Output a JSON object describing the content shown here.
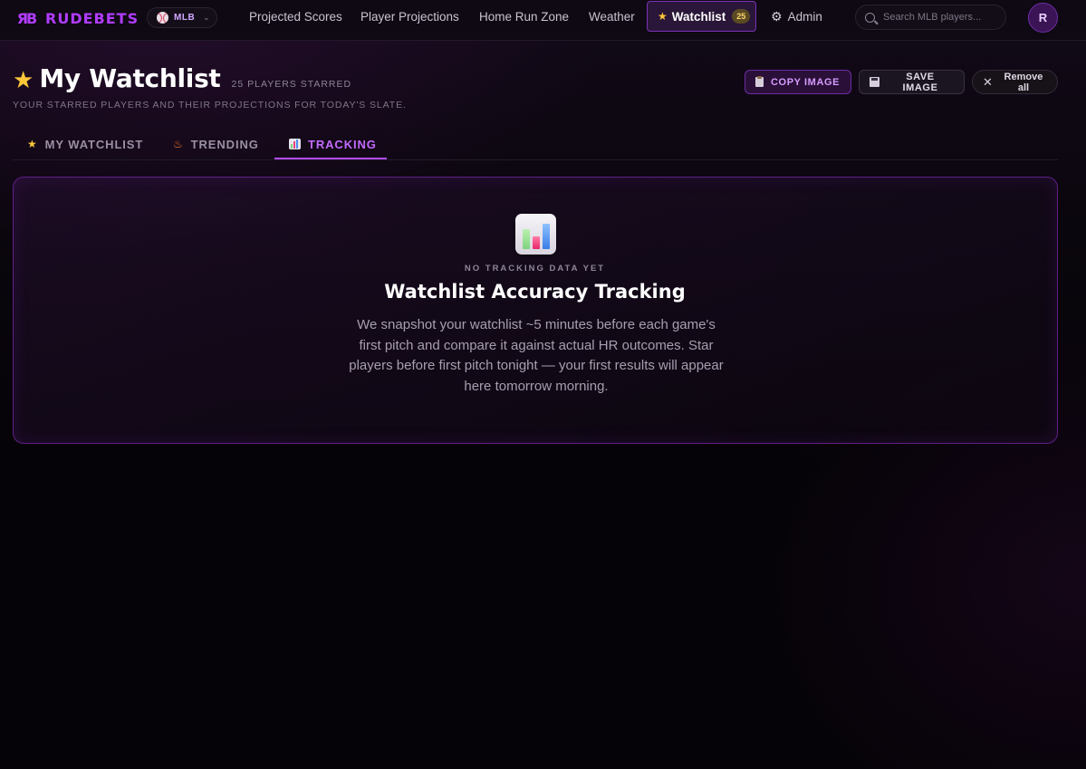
{
  "nav": {
    "brand_mark": "ЯB",
    "brand": "RUDEBETS",
    "sport": "MLB",
    "links": [
      "Projected Scores",
      "Player Projections",
      "Home Run Zone",
      "Weather"
    ],
    "watchlist_label": "Watchlist",
    "watchlist_count": "25",
    "admin_label": "Admin",
    "search_placeholder": "Search MLB players...",
    "avatar_initial": "R"
  },
  "header": {
    "title": "My Watchlist",
    "count": "25 PLAYERS STARRED",
    "subtitle": "YOUR STARRED PLAYERS AND THEIR PROJECTIONS FOR TODAY'S SLATE.",
    "actions": {
      "copy_label": "COPY IMAGE",
      "save_label": "SAVE IMAGE",
      "remove_label": "Remove all"
    }
  },
  "tabs": [
    {
      "label": "MY WATCHLIST",
      "icon": "star-icon",
      "active": false
    },
    {
      "label": "TRENDING",
      "icon": "fire-icon",
      "active": false
    },
    {
      "label": "TRACKING",
      "icon": "bar-chart-icon",
      "active": true
    }
  ],
  "empty_state": {
    "icon": "bar-chart-icon",
    "kicker": "NO TRACKING DATA YET",
    "title": "Watchlist Accuracy Tracking",
    "body": "We snapshot your watchlist ~5 minutes before each game's first pitch and compare it against actual HR outcomes. Star players before first pitch tonight — your first results will appear here tomorrow morning."
  },
  "colors": {
    "accent": "#b13cff",
    "star": "#ffc83a",
    "background": "#050307"
  }
}
